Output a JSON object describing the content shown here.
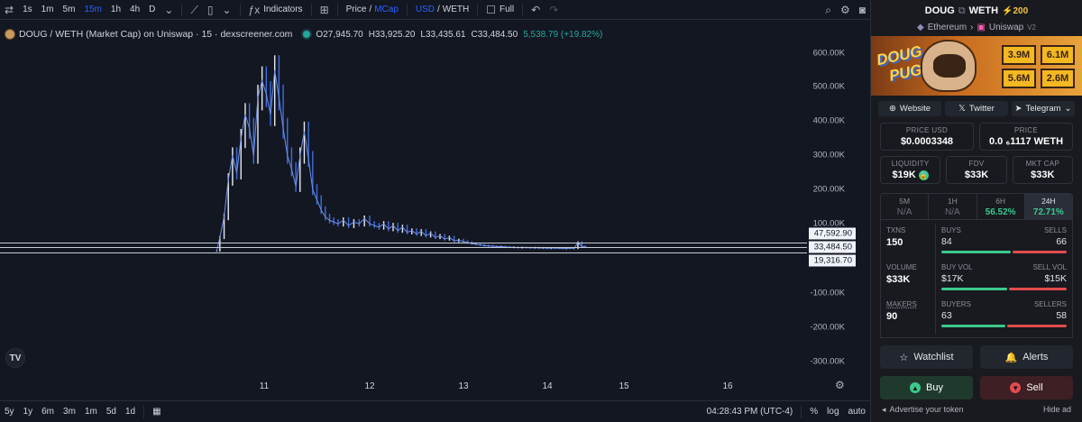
{
  "toolbar": {
    "intervals": [
      "1s",
      "1m",
      "5m",
      "15m",
      "1h",
      "4h",
      "D"
    ],
    "active_interval": "15m",
    "indicators_label": "Indicators",
    "price_label": "Price",
    "mcap_label": "MCap",
    "usd_label": "USD",
    "weth_label": "WETH",
    "full_label": "Full"
  },
  "legend": {
    "title": "DOUG / WETH (Market Cap) on Uniswap · 15 · dexscreener.com",
    "open": "O27,945.70",
    "high": "H33,925.20",
    "low": "L33,435.61",
    "close": "C33,484.50",
    "change": "5,538.79 (+19.82%)"
  },
  "price_scale": {
    "labels": [
      "600.00K",
      "500.00K",
      "400.00K",
      "300.00K",
      "200.00K",
      "100.00K",
      "0.00",
      "-100.00K",
      "-200.00K",
      "-300.00K"
    ],
    "tags": [
      "47,592.90",
      "33,484.50",
      "19,316.70"
    ]
  },
  "time_axis": {
    "labels": [
      "11",
      "12",
      "13",
      "14",
      "15",
      "16"
    ]
  },
  "bottom_bar": {
    "ranges": [
      "5y",
      "1y",
      "6m",
      "3m",
      "1m",
      "5d",
      "1d"
    ],
    "clock": "04:28:43 PM (UTC-4)",
    "percent": "%",
    "log": "log",
    "auto": "auto"
  },
  "tv_logo": "TV",
  "sidebar": {
    "pair": "DOUG",
    "pair_quote": "WETH",
    "boost": "⚡200",
    "chain": "Ethereum",
    "dex": "Uniswap",
    "dex_version": "V2",
    "banner": {
      "name_line1": "DOUG",
      "name_line2": "PUG",
      "stats": [
        "3.9M",
        "6.1M",
        "5.6M",
        "2.6M"
      ]
    },
    "links": [
      "Website",
      "Twitter",
      "Telegram"
    ],
    "price_usd_label": "PRICE USD",
    "price_usd": "$0.0003348",
    "price_label": "PRICE",
    "price_weth": "0.0 ₆1117 WETH",
    "liquidity_label": "LIQUIDITY",
    "liquidity": "$19K",
    "fdv_label": "FDV",
    "fdv": "$33K",
    "mktcap_label": "MKT CAP",
    "mktcap": "$33K",
    "timeframes": [
      {
        "name": "5M",
        "pct": "N/A"
      },
      {
        "name": "1H",
        "pct": "N/A"
      },
      {
        "name": "6H",
        "pct": "56.52%"
      },
      {
        "name": "24H",
        "pct": "72.71%"
      }
    ],
    "txns": {
      "label": "TXNS",
      "value": "150",
      "buys_label": "BUYS",
      "buys": "84",
      "sells_label": "SELLS",
      "sells": "66",
      "buy_fraction": 0.56
    },
    "volume": {
      "label": "VOLUME",
      "value": "$33K",
      "buy_label": "BUY VOL",
      "buy": "$17K",
      "sell_label": "SELL VOL",
      "sell": "$15K",
      "buy_fraction": 0.53
    },
    "makers": {
      "label": "MAKERS",
      "value": "90",
      "buyers_label": "BUYERS",
      "buyers": "63",
      "sellers_label": "SELLERS",
      "sellers": "58",
      "buy_fraction": 0.52
    },
    "watchlist_label": "Watchlist",
    "alerts_label": "Alerts",
    "buy_label": "Buy",
    "sell_label": "Sell",
    "advertise_label": "Advertise your token",
    "hide_ad_label": "Hide ad"
  },
  "chart_data": {
    "type": "line",
    "title": "DOUG / WETH (Market Cap) on Uniswap · 15 · dexscreener.com",
    "ylabel": "",
    "xlabel": "",
    "ylim": [
      -330000,
      630000
    ],
    "x_ticks": [
      "11",
      "12",
      "13",
      "14",
      "15",
      "16"
    ],
    "x_tick_days": [
      11,
      12,
      13,
      14,
      15,
      16
    ],
    "series": [
      {
        "x_days": [
          10.55,
          10.58,
          10.62,
          10.66,
          10.7,
          10.74,
          10.78,
          10.82,
          10.86,
          10.9,
          10.94,
          10.98,
          11.02,
          11.06,
          11.1,
          11.14,
          11.18,
          11.22,
          11.26,
          11.3,
          11.34,
          11.38,
          11.42,
          11.46,
          11.5,
          11.54,
          11.58,
          11.62,
          11.66,
          11.7,
          11.75,
          11.8,
          11.85,
          11.9,
          11.95,
          12.0,
          12.05,
          12.1,
          12.15,
          12.2,
          12.25,
          12.3,
          12.35,
          12.4,
          12.45,
          12.5,
          12.55,
          12.6,
          12.65,
          12.7,
          12.75,
          12.8,
          12.85,
          12.9,
          12.95,
          13.0,
          13.05,
          13.1,
          13.15,
          13.2,
          13.25,
          13.3,
          13.35,
          13.4,
          13.45,
          13.5,
          13.55,
          13.6,
          13.65,
          13.7,
          13.75,
          13.8,
          13.85,
          13.9,
          13.95,
          14.0,
          14.05,
          14.1,
          14.15,
          14.2,
          14.25,
          14.3,
          14.35,
          14.4,
          14.45,
          14.5
        ],
        "values": [
          20000,
          60000,
          120000,
          230000,
          300000,
          250000,
          350000,
          420000,
          380000,
          300000,
          470000,
          520000,
          480000,
          420000,
          550000,
          470000,
          380000,
          300000,
          260000,
          210000,
          300000,
          370000,
          290000,
          200000,
          170000,
          140000,
          120000,
          110000,
          105000,
          100000,
          110000,
          95000,
          105000,
          100000,
          115000,
          100000,
          95000,
          90000,
          100000,
          85000,
          95000,
          80000,
          90000,
          75000,
          80000,
          70000,
          78000,
          65000,
          72000,
          60000,
          65000,
          55000,
          60000,
          50000,
          52000,
          48000,
          45000,
          42000,
          40000,
          38000,
          36000,
          35000,
          34000,
          33000,
          33000,
          32000,
          31000,
          31000,
          30000,
          30500,
          30000,
          29500,
          30000,
          29000,
          29500,
          28000,
          29000,
          28500,
          28000,
          27500,
          28000,
          27900,
          27950,
          45000,
          33500,
          33484
        ]
      }
    ],
    "price_lines": [
      47592.9,
      33484.5,
      19316.7
    ]
  }
}
